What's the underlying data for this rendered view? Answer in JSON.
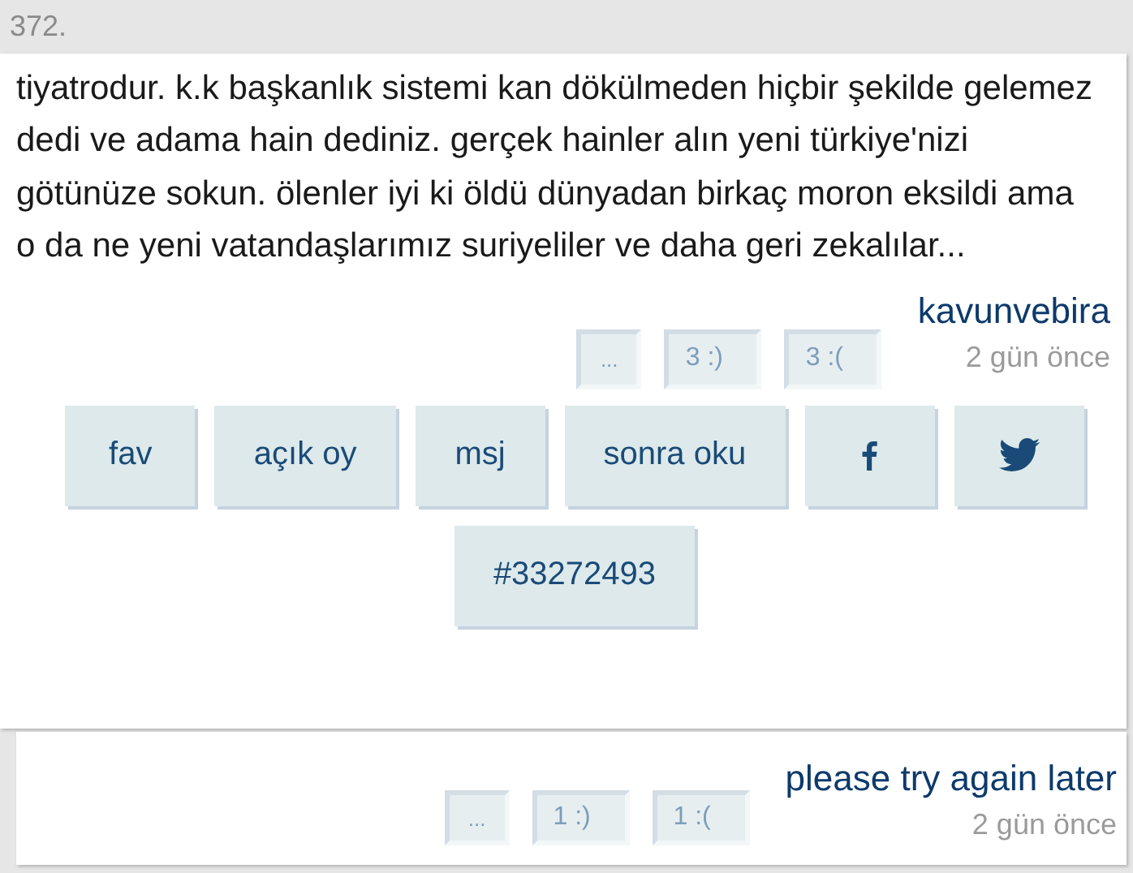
{
  "entry_number": "372.",
  "entries": [
    {
      "content": "tiyatrodur. k.k başkanlık sistemi kan dökülmeden hiçbir şekilde gelemez dedi ve adama hain dediniz. gerçek hainler alın yeni türkiye'nizi götünüze sokun. ölenler iyi ki öldü dünyadan birkaç moron eksildi ama o da ne yeni vatandaşlarımız suriyeliler ve daha geri zekalılar...",
      "votes": [
        {
          "kind": "more",
          "label": "..."
        },
        {
          "kind": "up",
          "label": "3 :)"
        },
        {
          "kind": "down",
          "label": "3 :("
        }
      ],
      "author": "kavunvebira",
      "date": "2 gün önce",
      "actions": [
        {
          "kind": "text",
          "label": "fav"
        },
        {
          "kind": "text",
          "label": "açık oy"
        },
        {
          "kind": "text",
          "label": "msj"
        },
        {
          "kind": "text",
          "label": "sonra oku"
        },
        {
          "kind": "facebook"
        },
        {
          "kind": "twitter"
        },
        {
          "kind": "text",
          "label": "#33272493"
        }
      ]
    },
    {
      "votes": [
        {
          "kind": "more",
          "label": "..."
        },
        {
          "kind": "up",
          "label": "1 :)"
        },
        {
          "kind": "down",
          "label": "1 :("
        }
      ],
      "author": "please try again later",
      "date": "2 gün önce"
    }
  ]
}
